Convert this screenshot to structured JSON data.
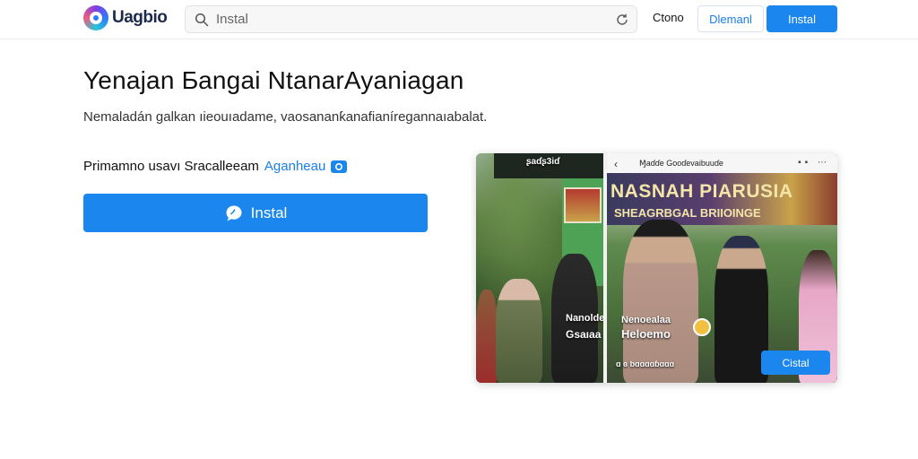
{
  "header": {
    "logo_text": "Uagbio",
    "search": {
      "value": "Instal"
    },
    "link": "Ctono",
    "outline_button": "Dlemanl",
    "primary_button": "Instal"
  },
  "main": {
    "title": "Yenajan Ƃangai NtanarAyaniagan",
    "subtitle": "Nemaladán galkan ıieouıadame, vaosananƙanafianíregannaıabalat.",
    "promo_text": "Primamno usavı Sracalleeam",
    "promo_link": "Aganheau",
    "install_label": "Instal"
  },
  "preview": {
    "left_top_text": "ʂaɗʂ3iɗ",
    "left_overlay_1": "Nanolde",
    "left_overlay_2": "Gsaıaa",
    "top_title": "Ɱaɗɗe Gooɗevaibuuɗe",
    "banner_line_1": "NASNAH PIARUSIA",
    "banner_line_2": "SHEAGRBGAL BRIIOINGE",
    "overlay_1": "Nenoealaa",
    "overlay_2": "Heloemo",
    "tiny_text": "ɑ ɞ ƅɑɑɑɑɓɑɑɑ",
    "button_label": "Cistal"
  },
  "colors": {
    "accent": "#1a86ee",
    "link": "#1a7fe8"
  },
  "icons": [
    "logo-icon",
    "search-icon",
    "refresh-icon",
    "chat-icon",
    "badge-icon",
    "back-icon",
    "more-icon",
    "play-icon"
  ]
}
